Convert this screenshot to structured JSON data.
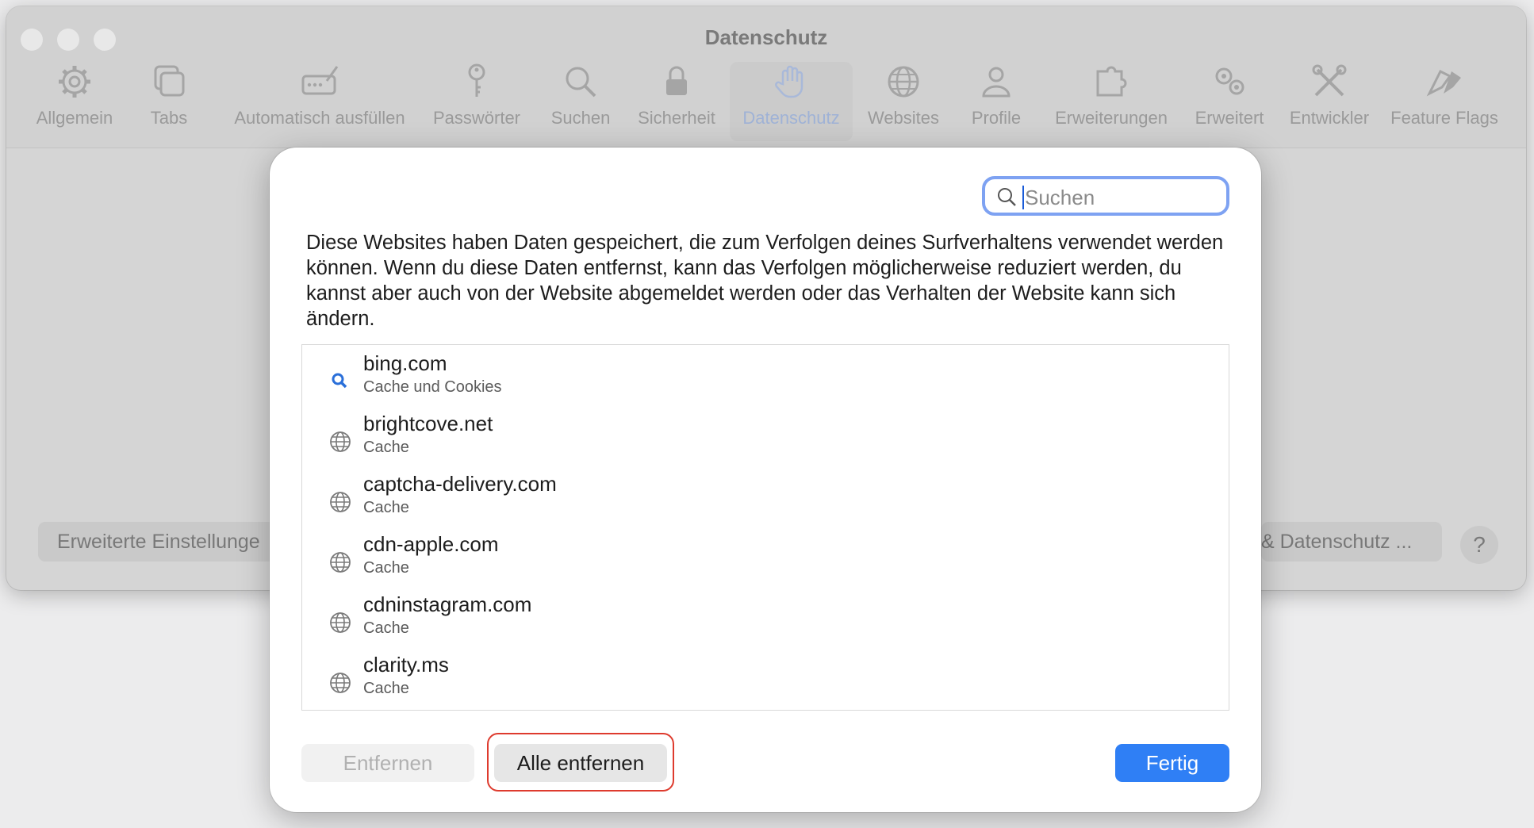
{
  "window": {
    "title": "Datenschutz",
    "toolbar": [
      {
        "label": "Allgemein",
        "icon": "gear-icon"
      },
      {
        "label": "Tabs",
        "icon": "tabs-icon"
      },
      {
        "label": "Automatisch ausfüllen",
        "icon": "autofill-icon"
      },
      {
        "label": "Passwörter",
        "icon": "key-icon"
      },
      {
        "label": "Suchen",
        "icon": "search-icon"
      },
      {
        "label": "Sicherheit",
        "icon": "lock-icon"
      },
      {
        "label": "Datenschutz",
        "icon": "hand-icon",
        "selected": true
      },
      {
        "label": "Websites",
        "icon": "globe-icon"
      },
      {
        "label": "Profile",
        "icon": "person-icon"
      },
      {
        "label": "Erweiterungen",
        "icon": "puzzle-icon"
      },
      {
        "label": "Erweitert",
        "icon": "gears-icon"
      },
      {
        "label": "Entwickler",
        "icon": "tools-icon"
      },
      {
        "label": "Feature Flags",
        "icon": "flags-icon"
      }
    ],
    "advanced_button": "Erweiterte Einstellunge",
    "privacy_button": "& Datenschutz ...",
    "help": "?"
  },
  "sheet": {
    "search_placeholder": "Suchen",
    "description": "Diese Websites haben Daten gespeichert, die zum Verfolgen deines Surfverhaltens verwendet werden können. Wenn du diese Daten entfernst, kann das Verfolgen möglicherweise reduziert werden, du kannst aber auch von der Website abgemeldet werden oder das Verhalten der Website kann sich ändern.",
    "sites": [
      {
        "domain": "bing.com",
        "data": "Cache und Cookies",
        "icon": "search-icon"
      },
      {
        "domain": "brightcove.net",
        "data": "Cache",
        "icon": "globe-icon"
      },
      {
        "domain": "captcha-delivery.com",
        "data": "Cache",
        "icon": "globe-icon"
      },
      {
        "domain": "cdn-apple.com",
        "data": "Cache",
        "icon": "globe-icon"
      },
      {
        "domain": "cdninstagram.com",
        "data": "Cache",
        "icon": "globe-icon"
      },
      {
        "domain": "clarity.ms",
        "data": "Cache",
        "icon": "globe-icon"
      }
    ],
    "buttons": {
      "remove": "Entfernen",
      "remove_all": "Alle entfernen",
      "done": "Fertig"
    },
    "colors": {
      "accent": "#2f7ff5",
      "highlight": "#de3b2e"
    }
  }
}
